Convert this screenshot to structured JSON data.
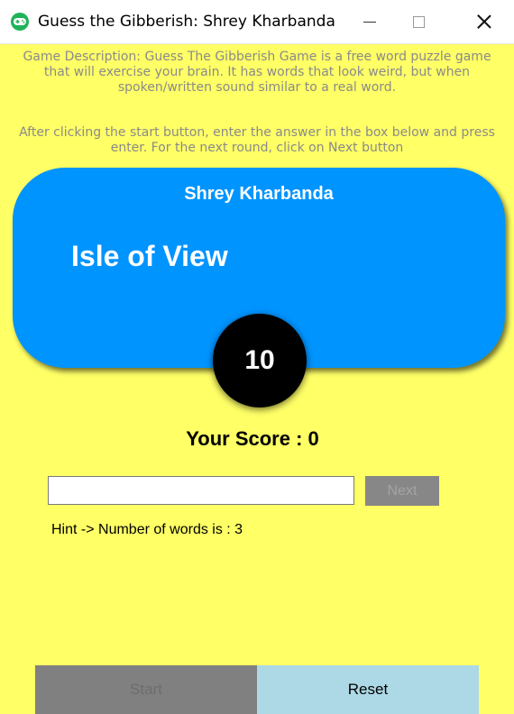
{
  "window": {
    "title": "Guess the Gibberish: Shrey Kharbanda",
    "app_icon": "gamepad-icon",
    "controls": [
      "minimize-icon",
      "maximize-icon",
      "close-icon"
    ]
  },
  "description": {
    "line1": "Game Description: Guess The Gibberish Game is a free word puzzle game that will exercise your brain. It has words that look weird, but when spoken/written sound similar to a real word.",
    "line2": "After clicking the start button, enter the answer in the box below and press enter.  For the next round, click on Next button"
  },
  "card": {
    "player_name": "Shrey Kharbanda",
    "gibberish": "Isle of View",
    "timer": "10"
  },
  "score": "Your Score : 0",
  "answer": {
    "value": "",
    "placeholder": ""
  },
  "next_label": "Next",
  "hint": "Hint -> Number of words is : 3",
  "start_label": "Start",
  "reset_label": "Reset",
  "colors": {
    "background": "#ffff66",
    "card": "#0094ff",
    "timer": "#000000",
    "reset": "#add8e6",
    "disabled": "#808080"
  }
}
